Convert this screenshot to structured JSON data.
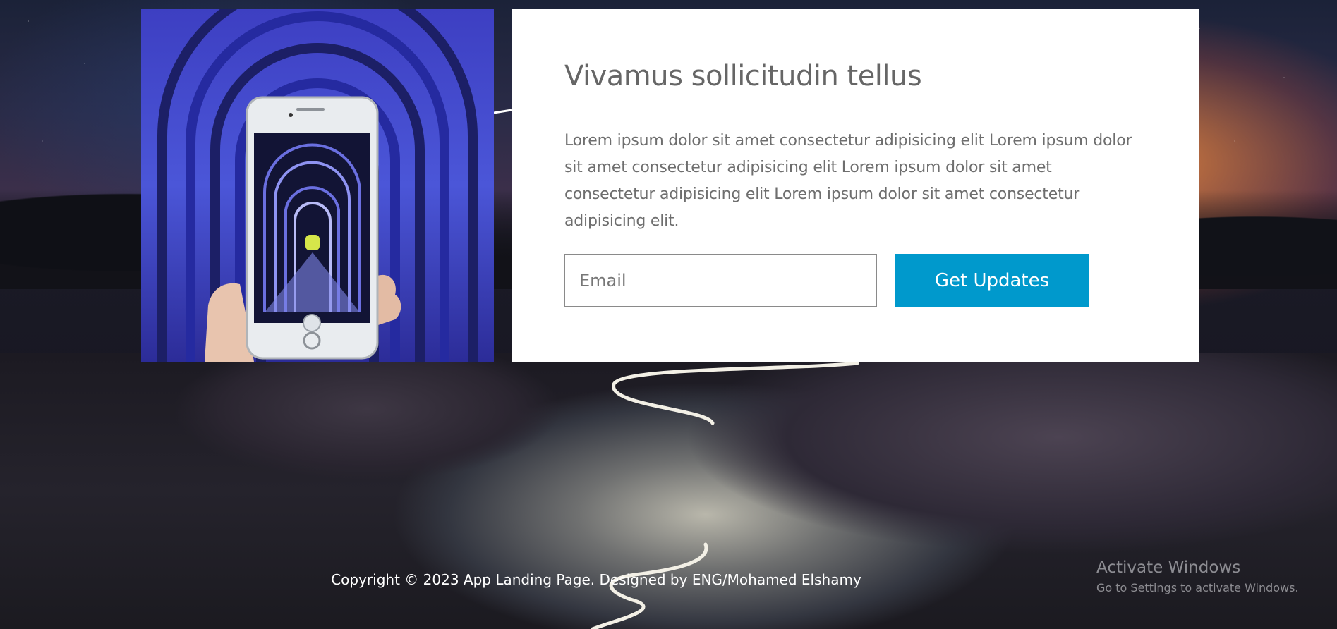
{
  "card": {
    "title": "Vivamus sollicitudin tellus",
    "body": "Lorem ipsum dolor sit amet consectetur adipisicing elit Lorem ipsum dolor sit amet consectetur adipisicing elit Lorem ipsum dolor sit amet consectetur adipisicing elit Lorem ipsum dolor sit amet consectetur adipisicing elit.",
    "email_placeholder": "Email",
    "email_value": "",
    "submit_label": "Get Updates"
  },
  "footer": {
    "copyright": "Copyright © 2023 App Landing Page. Designed by ENG/Mohamed Elshamy"
  },
  "os_watermark": {
    "title": "Activate Windows",
    "subtitle": "Go to Settings to activate Windows."
  },
  "colors": {
    "accent": "#0099cc",
    "card_background": "#ffffff",
    "text_muted": "#666666"
  },
  "icons": [
    "phone-camera-photo"
  ]
}
